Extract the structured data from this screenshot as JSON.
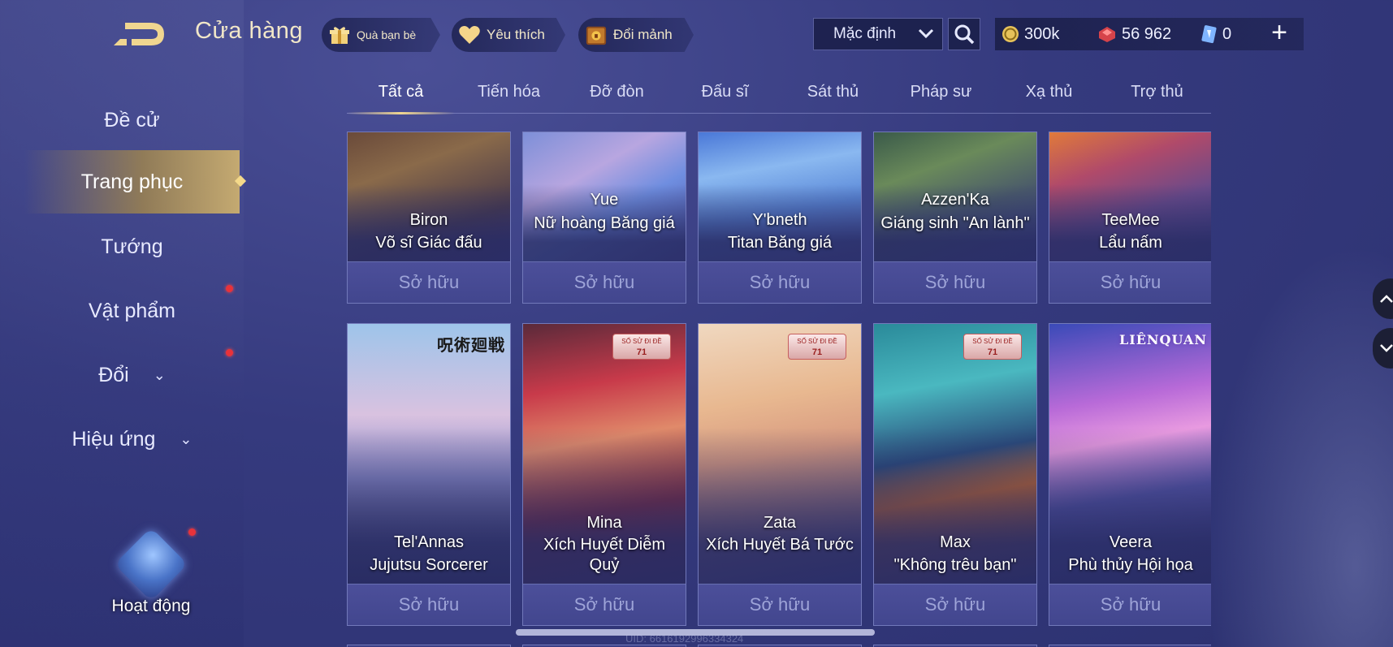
{
  "header": {
    "title": "Cửa hàng",
    "friends_gift": "Quà bạn bè",
    "favorites": "Yêu thích",
    "exchange_shards": "Đổi mảnh",
    "sort_value": "Mặc định",
    "currency": {
      "gold": "300k",
      "voucher": "56 962",
      "diamond": "0"
    }
  },
  "sidebar": {
    "items": [
      {
        "label": "Đề cử"
      },
      {
        "label": "Trang phục"
      },
      {
        "label": "Tướng"
      },
      {
        "label": "Vật phẩm"
      },
      {
        "label": "Đổi"
      },
      {
        "label": "Hiệu ứng"
      }
    ],
    "activity_label": "Hoạt động"
  },
  "tabs": [
    "Tất cả",
    "Tiến hóa",
    "Đỡ đòn",
    "Đấu sĩ",
    "Sát thủ",
    "Pháp sư",
    "Xạ thủ",
    "Trợ thủ"
  ],
  "owned_label": "Sở hữu",
  "row1": [
    {
      "hero": "Biron",
      "skin": "Võ sĩ Giác đấu"
    },
    {
      "hero": "Yue",
      "skin": "Nữ hoàng Băng giá"
    },
    {
      "hero": "Y'bneth",
      "skin": "Titan Băng giá"
    },
    {
      "hero": "Azzen'Ka",
      "skin": "Giáng sinh \"An lành\""
    },
    {
      "hero": "TeeMee",
      "skin": "Lẩu nấm"
    }
  ],
  "row2": [
    {
      "hero": "Tel'Annas",
      "skin": "Jujutsu Sorcerer"
    },
    {
      "hero": "Mina",
      "skin": "Xích Huyết Diễm Quỷ"
    },
    {
      "hero": "Zata",
      "skin": "Xích Huyết Bá Tước"
    },
    {
      "hero": "Max",
      "skin": "\"Không trêu bạn\""
    },
    {
      "hero": "Veera",
      "skin": "Phù thủy Hội họa"
    }
  ],
  "badges": {
    "jujutsu": "呪術廻戦",
    "sosuu_top": "SỐ SỬ ĐI ĐỀ",
    "sosuu_num": "71",
    "lienquan": "LIÊNQUAN"
  },
  "uid": "UID: 6616192996334324",
  "colors": {
    "accent_gold": "#f0d690",
    "background": "#353a7e",
    "notify": "#e8323a"
  }
}
